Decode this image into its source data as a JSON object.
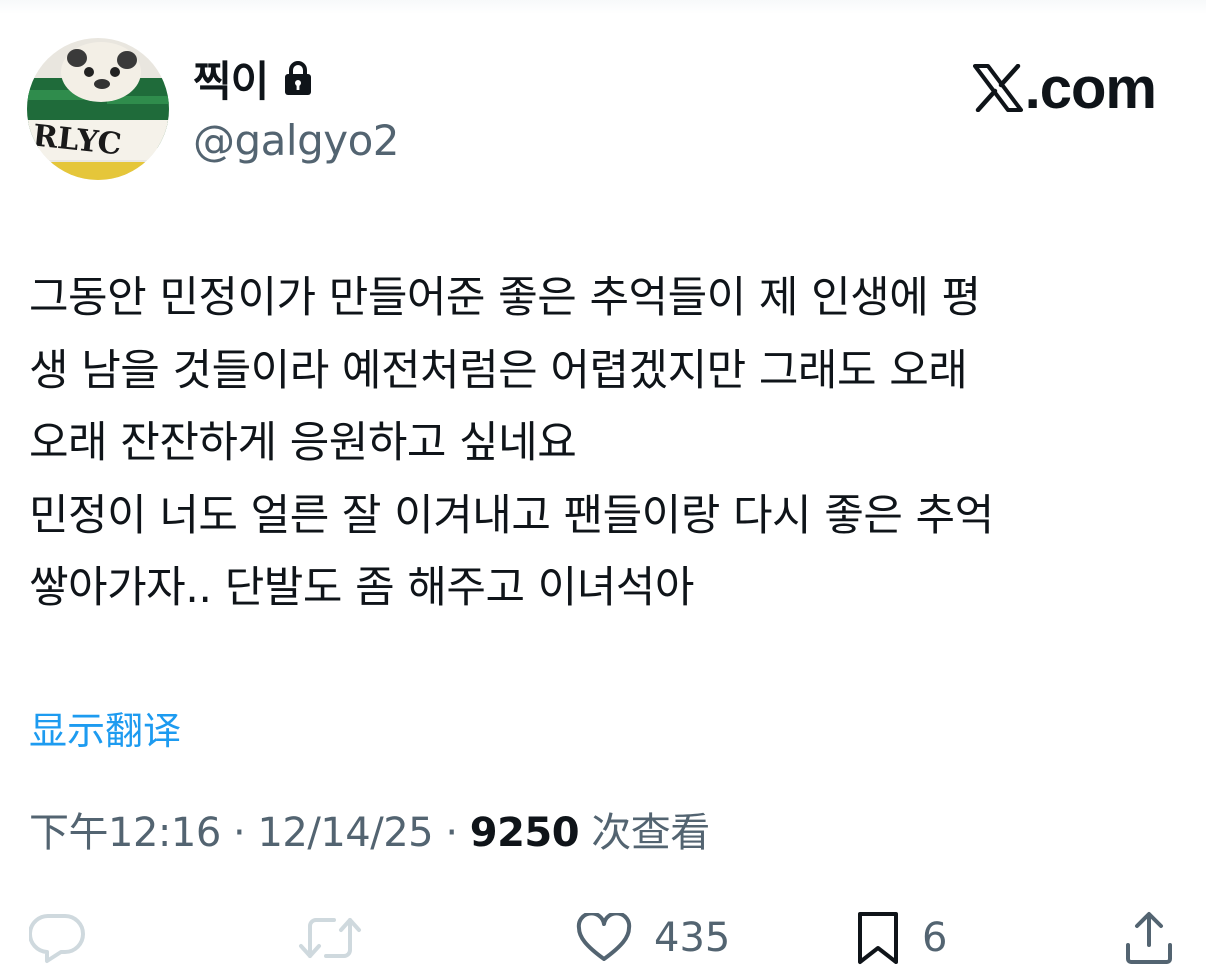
{
  "author": {
    "display_name": "찍이",
    "handle": "@galgyo2",
    "avatar_text": "RLYC"
  },
  "brand": {
    "text": ".com"
  },
  "tweet": {
    "lines": [
      "그동안 민정이가 만들어준 좋은 추억들이 제 인생에 평",
      "생 남을 것들이라 예전처럼은 어렵겠지만 그래도 오래",
      "오래 잔잔하게 응원하고 싶네요",
      "민정이 너도 얼른 잘 이겨내고 팬들이랑 다시 좋은 추억",
      "쌓아가자.. 단발도 좀 해주고 이녀석아"
    ]
  },
  "translate_label": "显示翻译",
  "meta": {
    "time": "下午12:16",
    "date": "12/14/25",
    "separator": "·",
    "views_count": "9250",
    "views_label": "次查看"
  },
  "actions": {
    "likes": "435",
    "bookmarks": "6"
  },
  "icons": [
    "lock-icon",
    "x-logo-icon",
    "reply-icon",
    "repost-icon",
    "like-icon",
    "bookmark-icon",
    "share-icon"
  ],
  "colors": {
    "text": "#0f1419",
    "secondary": "#536471",
    "link": "#1d9bf0",
    "icon_muted": "#cfd9de"
  }
}
